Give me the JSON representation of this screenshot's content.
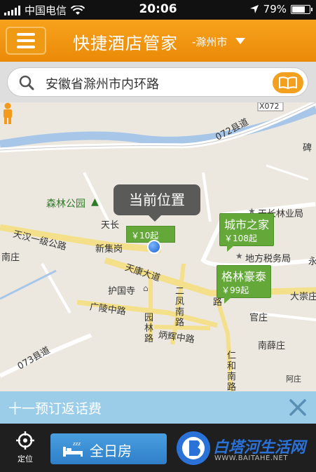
{
  "status_bar": {
    "carrier": "中国电信",
    "time": "20:06",
    "battery_percent": "79%",
    "battery_level": 0.79
  },
  "header": {
    "title": "快捷酒店管家",
    "city": "-滁州市",
    "menu_icon": "menu-icon",
    "dropdown_icon": "caret-down-icon"
  },
  "search": {
    "value": "安徽省滁州市内环路",
    "search_icon": "search-icon",
    "book_icon": "book-icon"
  },
  "map": {
    "current_location_label": "当前位置",
    "places": {
      "forest_park": "森林公园",
      "tianchang_forestry": "天长林业局",
      "tian": "天长",
      "xinjigang": "新集岗",
      "nanzhuang": "南庄",
      "huguosi": "护国寺",
      "tax_bureau": "地方税务局",
      "dachongzhuang": "大崇庄",
      "guanzhuang": "官庄",
      "nanxuezhuang": "南薛庄",
      "bei": "碑",
      "yong": "永",
      "ahe": "阿庄"
    },
    "roads": {
      "road_072_top": "072县道",
      "road_072_tag": "X072",
      "tianhan": "天汉一级公路",
      "tiankang": "天康大道",
      "guangling": "广陵中路",
      "yuanlin": "园林路",
      "binghui": "炳辉中路",
      "erfeng": "二凤南路",
      "renhe": "仁和南路",
      "road_073": "073县道",
      "lu": "路"
    },
    "hotels": [
      {
        "name": "城市之家",
        "price": "￥108起"
      },
      {
        "name": "格林豪泰",
        "price": "￥99起"
      }
    ],
    "partial_hotel_price": "￥10起",
    "hotel_color": "#64a83a",
    "location_dot_color": "#1d5fd1"
  },
  "promo": {
    "text": "十一预订返话费",
    "close_icon": "close-icon"
  },
  "bottom_bar": {
    "locate_label": "定位",
    "locate_icon": "crosshair-icon",
    "room_type": "全日房",
    "bed_icon": "bed-icon"
  },
  "watermark": {
    "title": "白塔河生活网",
    "url": "WWW.BAITAHE.NET"
  },
  "colors": {
    "accent": "#ea8a08",
    "promo_bg": "#9ccde8",
    "button_blue": "#2f7fc8"
  }
}
